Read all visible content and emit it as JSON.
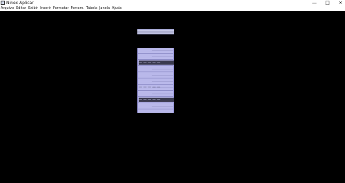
{
  "window": {
    "title": "Ninex Aplicar",
    "controls": {
      "minimize": "—",
      "restore": "□",
      "close": "×"
    }
  },
  "menubar": {
    "items": [
      "Arquivo",
      "Editar",
      "Exibir",
      "Inserir",
      "Formatar",
      "Ferram.",
      "Tabela",
      "Janela",
      "Ajuda"
    ]
  },
  "panel": {
    "rows": [
      {
        "text": "",
        "dark": false
      },
      {
        "text": "",
        "dark": false
      },
      {
        "text": "— — — — —",
        "dark": true
      },
      {
        "text": "",
        "dark": false
      },
      {
        "text": "",
        "dark": false
      },
      {
        "text": "",
        "dark": false
      },
      {
        "text": "— — — — —",
        "dark": false
      },
      {
        "text": "",
        "dark": false
      },
      {
        "text": "— — — — —",
        "dark": true
      },
      {
        "text": "",
        "dark": false
      },
      {
        "text": "",
        "dark": false
      }
    ]
  },
  "colors": {
    "background": "#000000",
    "panel": "#b9b8ea",
    "strip": "#c7c9e6"
  }
}
